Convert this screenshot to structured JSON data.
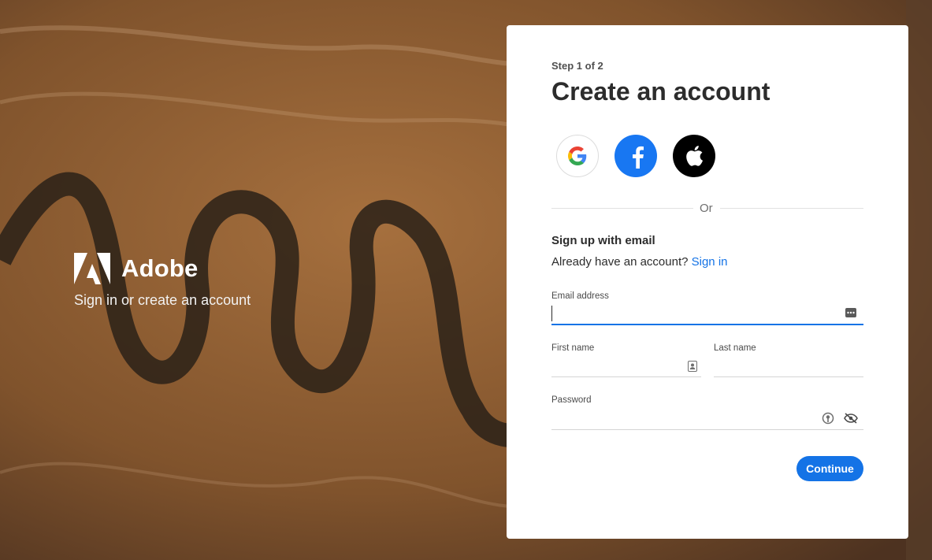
{
  "brand": {
    "name": "Adobe",
    "tagline": "Sign in or create an account"
  },
  "form": {
    "step": "Step 1 of 2",
    "title": "Create an account",
    "social": [
      {
        "name": "Google",
        "icon": "google-icon"
      },
      {
        "name": "Facebook",
        "icon": "facebook-icon"
      },
      {
        "name": "Apple",
        "icon": "apple-icon"
      }
    ],
    "divider_text": "Or",
    "signup_title": "Sign up with email",
    "account_prompt": "Already have an account?",
    "signin_link": "Sign in",
    "email": {
      "label": "Email address",
      "value": ""
    },
    "first_name": {
      "label": "First name",
      "value": ""
    },
    "last_name": {
      "label": "Last name",
      "value": ""
    },
    "password": {
      "label": "Password",
      "value": ""
    },
    "continue_label": "Continue"
  },
  "colors": {
    "accent": "#1473e6",
    "facebook": "#1877f2",
    "apple": "#000000",
    "card": "#ffffff"
  }
}
